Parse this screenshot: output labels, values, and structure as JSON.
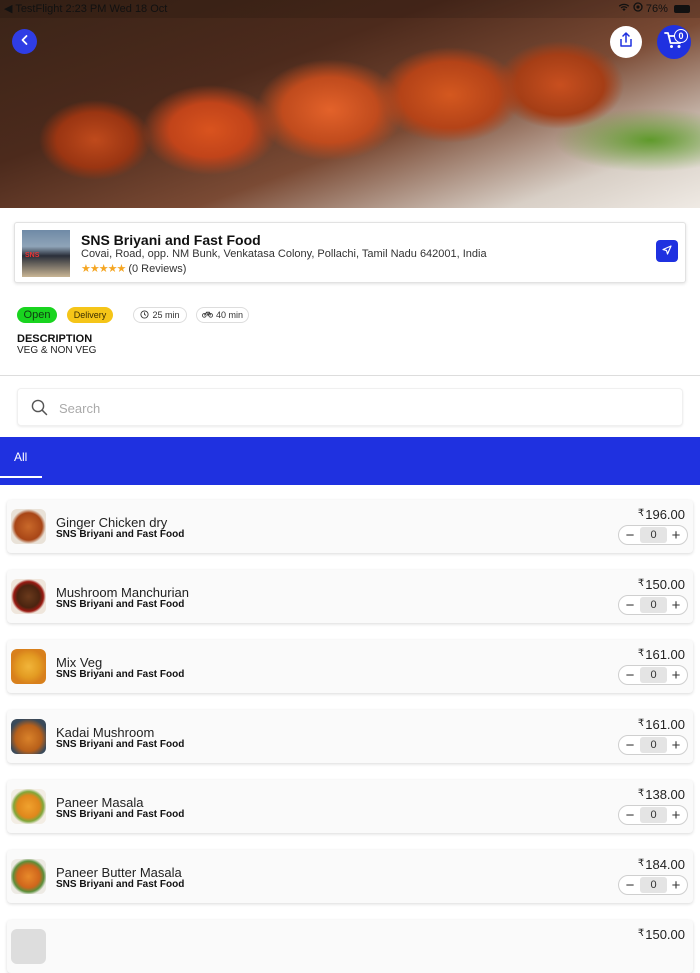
{
  "status_bar": {
    "left": "◀ TestFlight  2:23 PM  Wed 18 Oct",
    "battery": "76%"
  },
  "header": {
    "cart_count": "0"
  },
  "restaurant": {
    "name": "SNS Briyani and Fast Food",
    "address": "Covai, Road, opp. NM Bunk, Venkatasa Colony, Pollachi, Tamil Nadu 642001, India",
    "stars": "★★★★★",
    "reviews": "(0 Reviews)"
  },
  "chips": {
    "open": "Open",
    "delivery": "Delivery",
    "prep_time": "25 min",
    "ride_time": "40 min"
  },
  "description": {
    "label": "DESCRIPTION",
    "value": "VEG & NON VEG"
  },
  "search": {
    "placeholder": "Search"
  },
  "tabs": [
    {
      "label": "All"
    }
  ],
  "menu_items": [
    {
      "name": "Ginger Chicken dry",
      "restaurant": "SNS Briyani and Fast Food",
      "price": "196.00",
      "qty": "0"
    },
    {
      "name": "Mushroom Manchurian",
      "restaurant": "SNS Briyani and Fast Food",
      "price": "150.00",
      "qty": "0"
    },
    {
      "name": "Mix Veg",
      "restaurant": "SNS Briyani and Fast Food",
      "price": "161.00",
      "qty": "0"
    },
    {
      "name": "Kadai Mushroom",
      "restaurant": "SNS Briyani and Fast Food",
      "price": "161.00",
      "qty": "0"
    },
    {
      "name": "Paneer Masala",
      "restaurant": "SNS Briyani and Fast Food",
      "price": "138.00",
      "qty": "0"
    },
    {
      "name": "Paneer Butter Masala",
      "restaurant": "SNS Briyani and Fast Food",
      "price": "184.00",
      "qty": "0"
    },
    {
      "name": "",
      "restaurant": "",
      "price": "150.00",
      "qty": ""
    }
  ],
  "currency_symbol": "₹",
  "colors": {
    "brand_blue": "#1f31e0",
    "open_green": "#19d41f",
    "delivery_yellow": "#f5c518",
    "star_orange": "#f5a623"
  }
}
